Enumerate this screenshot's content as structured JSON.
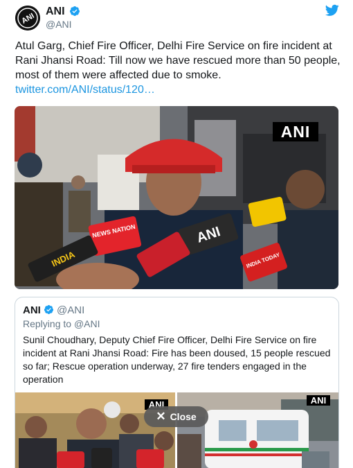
{
  "tweet": {
    "author_name": "ANI",
    "author_handle": "@ANI",
    "avatar_text": "ANI",
    "text": "Atul Garg, Chief Fire Officer, Delhi Fire Service on fire incident at Rani Jhansi Road: Till now we have rescued more than 50 people, most of them were affected due to smoke.",
    "link": "twitter.com/ANI/status/120…",
    "image_badge": "ANI",
    "image_mic_labels": [
      "NEWS NATION",
      "ANI",
      "INDIA TODAY",
      "INDIA"
    ]
  },
  "quoted": {
    "author_name": "ANI",
    "author_handle": "@ANI",
    "replying_label": "Replying to",
    "replying_handle": "@ANI",
    "text": "Sunil Choudhary, Deputy Chief Fire Officer, Delhi Fire Service on fire incident at Rani Jhansi Road: Fire has been doused, 15 people rescued so far; Rescue operation underway, 27 fire tenders engaged in the operation",
    "image_badges": [
      "ANI",
      "ANI"
    ]
  },
  "overlay": {
    "close_label": "Close",
    "close_icon": "✕"
  },
  "icons": {
    "verified": "verified-badge-icon",
    "twitter": "twitter-bird-icon"
  },
  "colors": {
    "link": "#1b95e0",
    "verified": "#1da1f2",
    "secondary_text": "#657786",
    "border": "#ccd6dd"
  }
}
